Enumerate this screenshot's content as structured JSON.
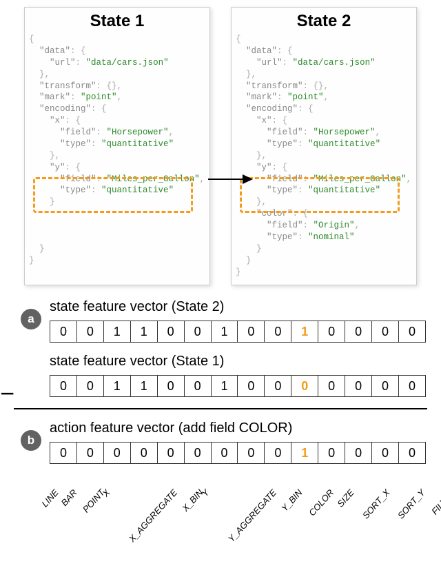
{
  "states": {
    "state1": {
      "title": "State 1",
      "json": {
        "data": {
          "url": "data/cars.json"
        },
        "transform": "{}",
        "mark": "point",
        "encoding": {
          "x": {
            "field": "Horsepower",
            "type": "quantitative"
          },
          "y": {
            "field": "Miles_per_Gallon",
            "type": "quantitative"
          }
        }
      }
    },
    "state2": {
      "title": "State 2",
      "json": {
        "data": {
          "url": "data/cars.json"
        },
        "transform": "{}",
        "mark": "point",
        "encoding": {
          "x": {
            "field": "Horsepower",
            "type": "quantitative"
          },
          "y": {
            "field": "Miles_per_Gallon",
            "type": "quantitative"
          },
          "color": {
            "field": "Origin",
            "type": "nominal"
          }
        }
      }
    }
  },
  "badges": {
    "a": "a",
    "b": "b",
    "minus": "−"
  },
  "sectionA": {
    "title1": "state feature vector (State 2)",
    "vector1": [
      0,
      0,
      1,
      1,
      0,
      0,
      1,
      0,
      0,
      1,
      0,
      0,
      0,
      0
    ],
    "highlight1": 9,
    "title2": "state feature vector (State 1)",
    "vector2": [
      0,
      0,
      1,
      1,
      0,
      0,
      1,
      0,
      0,
      0,
      0,
      0,
      0,
      0
    ],
    "highlight2": 9
  },
  "sectionB": {
    "title": "action feature vector (add field COLOR)",
    "vector": [
      0,
      0,
      0,
      0,
      0,
      0,
      0,
      0,
      0,
      1,
      0,
      0,
      0,
      0
    ],
    "highlight": 9
  },
  "labels": [
    "LINE",
    "BAR",
    "POINT",
    "X",
    "X_AGGREGATE",
    "X_BIN",
    "Y",
    "Y_AGGREGATE",
    "Y_BIN",
    "COLOR",
    "SIZE",
    "SORT_X",
    "SORT_Y",
    "FILTER"
  ]
}
